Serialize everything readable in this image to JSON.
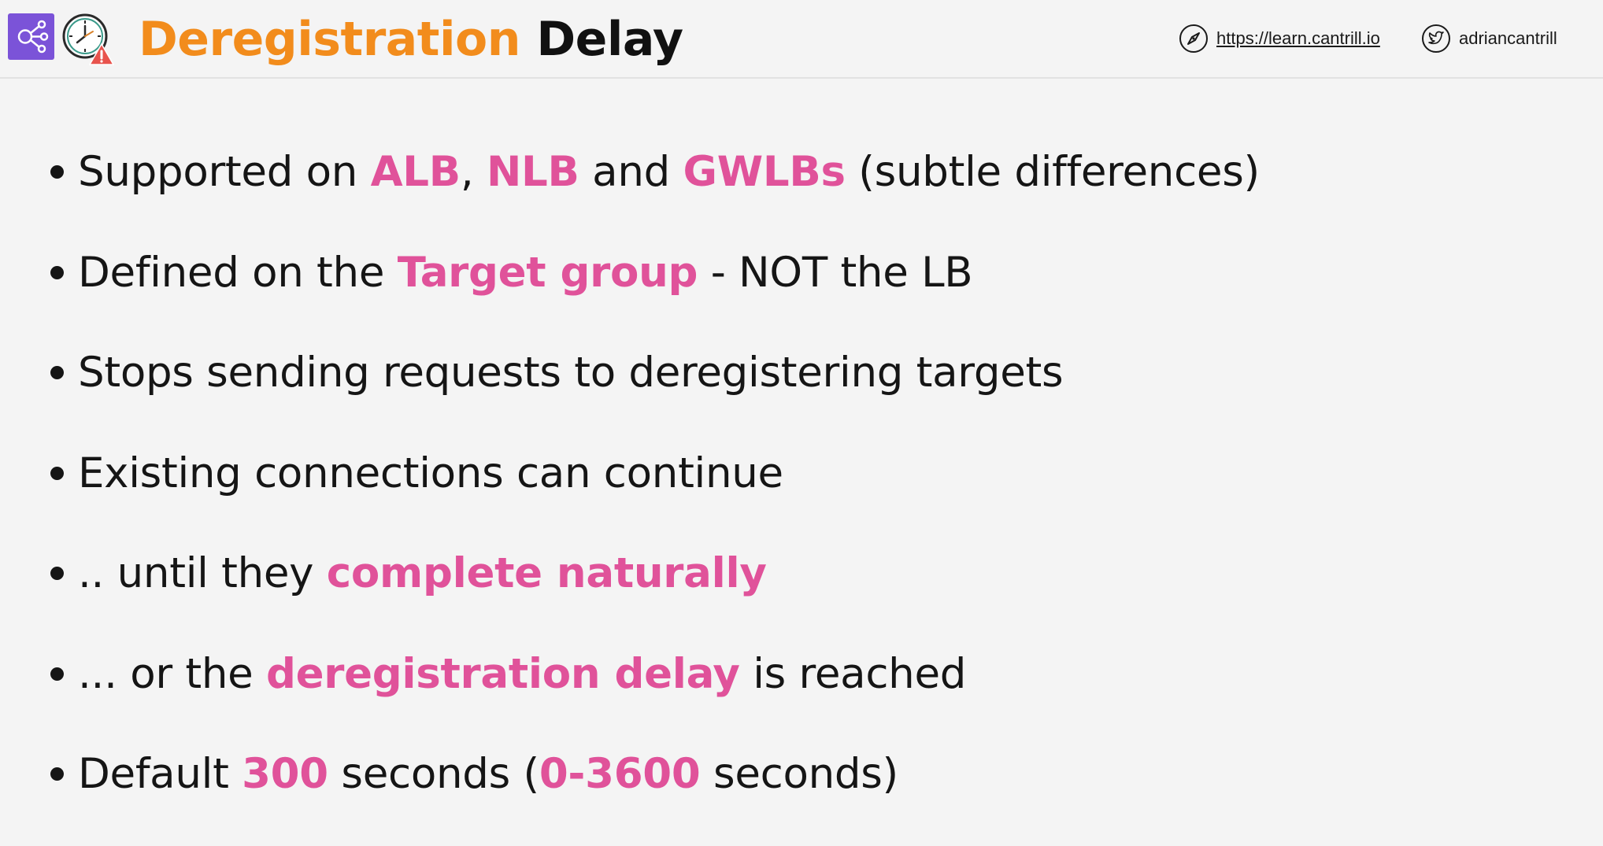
{
  "header": {
    "title_accent": "Deregistration",
    "title_rest": "Delay",
    "link_text": "https://learn.cantrill.io",
    "twitter_handle": "adriancantrill",
    "icons": [
      "elastic-load-balancing-icon",
      "clock-warning-icon",
      "compass-icon",
      "twitter-icon"
    ]
  },
  "colors": {
    "title_accent": "#f28c1c",
    "highlight": "#e0529a",
    "icon_bg": "#7b53d8",
    "warning": "#e8534d"
  },
  "bullets": [
    [
      {
        "t": "Supported on ",
        "hl": false
      },
      {
        "t": "ALB",
        "hl": true
      },
      {
        "t": ", ",
        "hl": false
      },
      {
        "t": "NLB",
        "hl": true
      },
      {
        "t": " and ",
        "hl": false
      },
      {
        "t": "GWLBs",
        "hl": true
      },
      {
        "t": " (subtle differences)",
        "hl": false
      }
    ],
    [
      {
        "t": "Defined on the ",
        "hl": false
      },
      {
        "t": "Target group",
        "hl": true
      },
      {
        "t": " - NOT the LB",
        "hl": false
      }
    ],
    [
      {
        "t": "Stops sending requests to deregistering targets",
        "hl": false
      }
    ],
    [
      {
        "t": "Existing connections can continue",
        "hl": false
      }
    ],
    [
      {
        "t": ".. until they ",
        "hl": false
      },
      {
        "t": "complete naturally",
        "hl": true
      }
    ],
    [
      {
        "t": "... or the ",
        "hl": false
      },
      {
        "t": "deregistration delay",
        "hl": true
      },
      {
        "t": " is reached",
        "hl": false
      }
    ],
    [
      {
        "t": "Default ",
        "hl": false
      },
      {
        "t": "300",
        "hl": true
      },
      {
        "t": " seconds (",
        "hl": false
      },
      {
        "t": "0-3600",
        "hl": true
      },
      {
        "t": " seconds)",
        "hl": false
      }
    ]
  ]
}
